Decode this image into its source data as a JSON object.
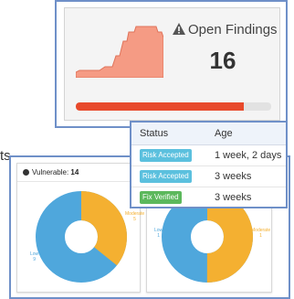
{
  "findings": {
    "title": "Open Findings",
    "count": "16",
    "progress": 0.86,
    "colors": {
      "sparkline": "#f59b84",
      "progress": "#e8492b"
    }
  },
  "status_table": {
    "headers": {
      "status": "Status",
      "age": "Age"
    },
    "rows": [
      {
        "status": "Risk Accepted",
        "age": "1 week, 2 days",
        "status_color": "#5bc0de"
      },
      {
        "status": "Risk Accepted",
        "age": "3 weeks",
        "status_color": "#5bc0de"
      },
      {
        "status": "Fix Verified",
        "age": "3 weeks",
        "status_color": "#5cb85c"
      }
    ]
  },
  "background": {
    "cutoff_text": "ts",
    "left_panel": {
      "label": "Vulnerable:",
      "count": "14",
      "slices": [
        {
          "label": "Moderate",
          "value": "5",
          "color": "#f4b031"
        },
        {
          "label": "Low",
          "value": "9",
          "color": "#4fa7dc"
        }
      ]
    },
    "right_panel": {
      "slices": [
        {
          "label": "Moderate",
          "value": "1",
          "color": "#f4b031"
        },
        {
          "label": "Low",
          "value": "1",
          "color": "#4fa7dc"
        }
      ]
    }
  }
}
